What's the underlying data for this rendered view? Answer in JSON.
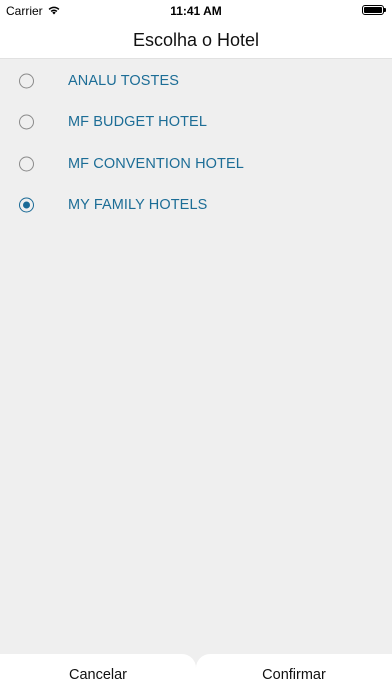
{
  "status_bar": {
    "carrier": "Carrier",
    "time": "11:41 AM"
  },
  "header": {
    "title": "Escolha o Hotel"
  },
  "hotels": [
    {
      "name": "ANALU TOSTES",
      "selected": false
    },
    {
      "name": "MF BUDGET HOTEL",
      "selected": false
    },
    {
      "name": "MF CONVENTION HOTEL",
      "selected": false
    },
    {
      "name": "MY FAMILY HOTELS",
      "selected": true
    }
  ],
  "footer": {
    "cancel_label": "Cancelar",
    "confirm_label": "Confirmar"
  },
  "colors": {
    "accent": "#1c6d96",
    "background": "#efefef",
    "surface": "#ffffff"
  },
  "icons": {
    "wifi": "wifi-icon",
    "battery": "battery-icon",
    "radio_on": "radio-checked-icon",
    "radio_off": "radio-unchecked-icon"
  }
}
